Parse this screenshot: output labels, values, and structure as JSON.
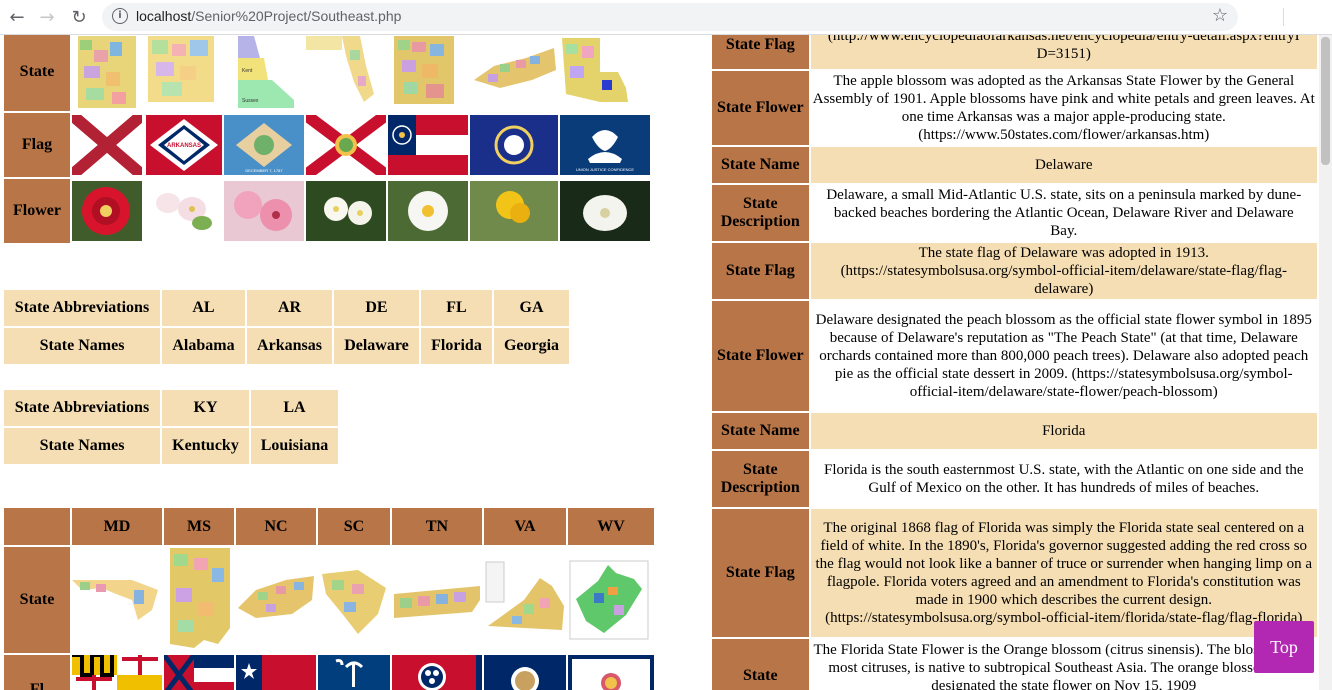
{
  "browser": {
    "url_host": "localhost",
    "url_path": "/Senior%20Project/Southeast.php"
  },
  "grid1": {
    "row_labels": [
      "State",
      "Flag",
      "Flower"
    ]
  },
  "abbr_table1": {
    "label_abbr": "State Abbreviations",
    "label_names": "State Names",
    "abbrs": [
      "AL",
      "AR",
      "DE",
      "FL",
      "GA"
    ],
    "names": [
      "Alabama",
      "Arkansas",
      "Delaware",
      "Florida",
      "Georgia"
    ]
  },
  "abbr_table2": {
    "label_abbr": "State Abbreviations",
    "label_names": "State Names",
    "abbrs": [
      "KY",
      "LA"
    ],
    "names": [
      "Kentucky",
      "Louisiana"
    ]
  },
  "grid2": {
    "headers": [
      "MD",
      "MS",
      "NC",
      "SC",
      "TN",
      "VA",
      "WV"
    ],
    "row_labels": [
      "State",
      "Fl"
    ]
  },
  "info_rows": [
    {
      "label": "State Flag",
      "value": "(http://www.encyclopediaofarkansas.net/encyclopedia/entry-detail.aspx?entryID=3151)"
    },
    {
      "label": "State Flower",
      "value": "The apple blossom was adopted as the Arkansas State Flower by the General Assembly of 1901. Apple blossoms have pink and white petals and green leaves. At one time Arkansas was a major apple-producing state. (https://www.50states.com/flower/arkansas.htm)"
    },
    {
      "label": "State Name",
      "value": "Delaware"
    },
    {
      "label": "State Description",
      "value": "Delaware, a small Mid-Atlantic U.S. state, sits on a peninsula marked by dune-backed beaches bordering the Atlantic Ocean, Delaware River and Delaware Bay."
    },
    {
      "label": "State Flag",
      "value": "The state flag of Delaware was adopted in 1913. (https://statesymbolsusa.org/symbol-official-item/delaware/state-flag/flag-delaware)"
    },
    {
      "label": "State Flower",
      "value": "Delaware designated the peach blossom as the official state flower symbol in 1895 because of Delaware's reputation as \"The Peach State\" (at that time, Delaware orchards contained more than 800,000 peach trees). Delaware also adopted peach pie as the official state dessert in 2009. (https://statesymbolsusa.org/symbol-official-item/delaware/state-flower/peach-blossom)"
    },
    {
      "label": "State Name",
      "value": "Florida"
    },
    {
      "label": "State Description",
      "value": "Florida is the south easternmost U.S. state, with the Atlantic on one side and the Gulf of Mexico on the other. It has hundreds of miles of beaches."
    },
    {
      "label": "State Flag",
      "value": "The original 1868 flag of Florida was simply the Florida state seal centered on a field of white. In the 1890's, Florida's governor suggested adding the red cross so the flag would not look like a banner of truce or surrender when hanging limp on a flagpole. Florida voters agreed and an amendment to Florida's constitution was made in 1900 which describes the current design. (https://statesymbolsusa.org/symbol-official-item/florida/state-flag/flag-florida)"
    },
    {
      "label": "State",
      "value": "The Florida State Flower is the Orange blossom (citrus sinensis). The blossom, like most citruses, is native to subtropical Southeast Asia. The orange blossom was designated the state flower on Nov 15, 1909"
    }
  ],
  "top_button": "Top",
  "colors": {
    "header": "#b87547",
    "cream": "#f5deb3",
    "top_button": "#b328b3"
  }
}
